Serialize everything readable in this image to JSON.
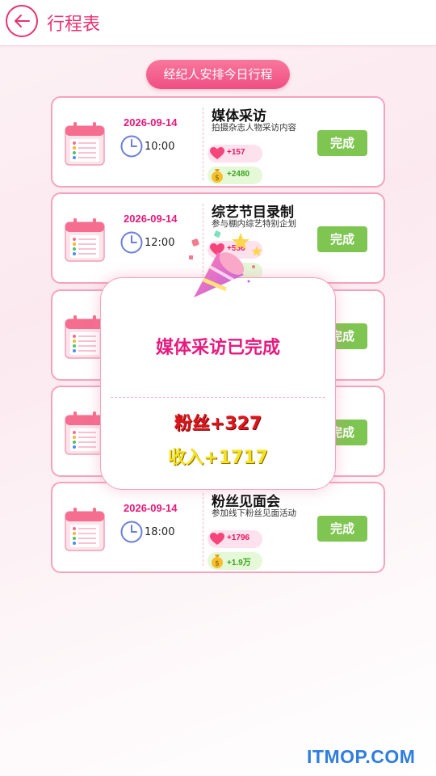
{
  "header": {
    "title": "行程表"
  },
  "banner": {
    "label": "经纪人安排今日行程"
  },
  "schedule": [
    {
      "date": "2026-09-14",
      "time": "10:00",
      "title": "媒体采访",
      "desc": "拍摄杂志人物采访内容",
      "fans": "+157",
      "income": "+2480",
      "button": "完成"
    },
    {
      "date": "2026-09-14",
      "time": "12:00",
      "title": "综艺节目录制",
      "desc": "参与棚内综艺特别企划",
      "fans": "+556",
      "income": "+27",
      "button": "完成"
    },
    {
      "date": "",
      "time": "",
      "title": "",
      "desc": "",
      "fans": "",
      "income": "",
      "button": "完成"
    },
    {
      "date": "",
      "time": "",
      "title": "",
      "desc": "",
      "fans": "",
      "income": "",
      "button": "完成"
    },
    {
      "date": "2026-09-14",
      "time": "18:00",
      "title": "粉丝见面会",
      "desc": "参加线下粉丝见面活动",
      "fans": "+1796",
      "income": "+1.9万",
      "button": "完成"
    }
  ],
  "popup": {
    "message": "媒体采访已完成",
    "fans": "粉丝+327",
    "income": "收入+1717"
  },
  "watermark": "ITMOP.COM",
  "colors": {
    "accent": "#e8336f",
    "done": "#7ec552",
    "date": "#e3197a"
  }
}
